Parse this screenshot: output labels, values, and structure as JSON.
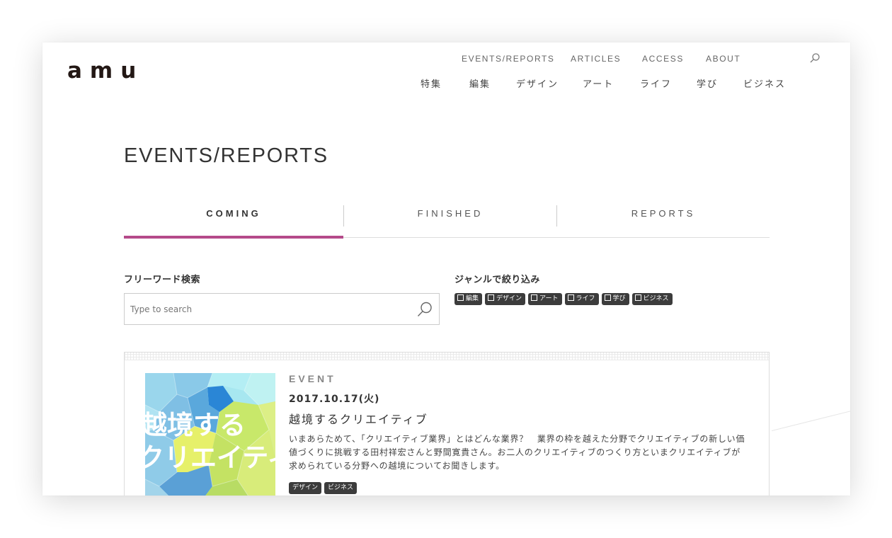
{
  "brand": {
    "logo": "amu"
  },
  "top_nav": {
    "items": [
      "EVENTS/REPORTS",
      "ARTICLES",
      "ACCESS",
      "ABOUT"
    ]
  },
  "genre_nav": {
    "items": [
      "特集",
      "編集",
      "デザイン",
      "アート",
      "ライフ",
      "学び",
      "ビジネス"
    ]
  },
  "page": {
    "title": "EVENTS/REPORTS"
  },
  "tabs": [
    {
      "label": "COMING",
      "active": true
    },
    {
      "label": "FINISHED",
      "active": false
    },
    {
      "label": "REPORTS",
      "active": false
    }
  ],
  "search": {
    "label": "フリーワード検索",
    "placeholder": "Type to search",
    "value": ""
  },
  "genre_filter": {
    "label": "ジャンルで絞り込み",
    "options": [
      "編集",
      "デザイン",
      "アート",
      "ライフ",
      "学び",
      "ビジネス"
    ]
  },
  "event_card": {
    "category": "EVENT",
    "date": "2017.10.17(火)",
    "title": "越境するクリエイティブ",
    "description": "いまあらためて、「クリエイティブ業界」とはどんな業界？　業界の枠を越えた分野でクリエイティブの新しい価値づくりに挑戦する田村祥宏さんと野間寛貴さん。お二人のクリエイティブのつくり方といまクリエイティブが求められている分野への越境についてお聞きします。",
    "tags": [
      "デザイン",
      "ビジネス"
    ],
    "thumbnail_text": [
      "越境する",
      "クリエイティブ"
    ]
  },
  "colors": {
    "accent": "#b54a8a",
    "chip_bg": "#3c3c3c",
    "text": "#333333"
  }
}
